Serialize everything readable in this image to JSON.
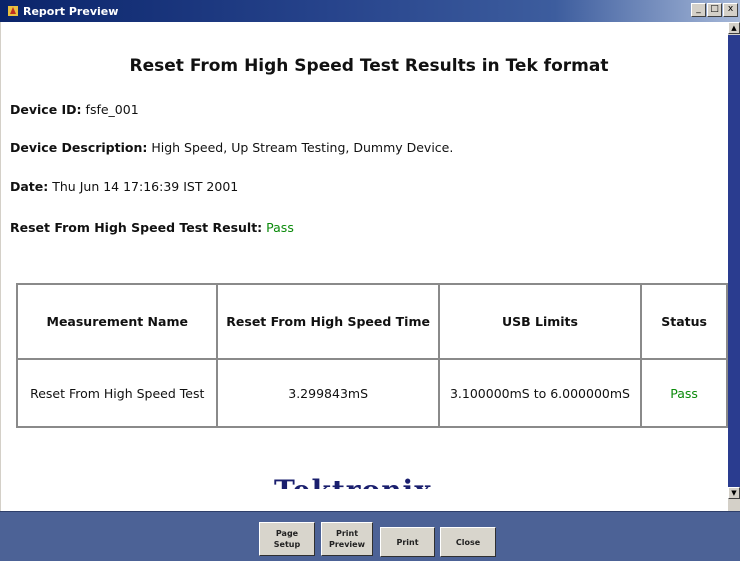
{
  "window": {
    "title": "Report Preview",
    "controls": {
      "minimize": "_",
      "maximize": "□",
      "close": "x"
    }
  },
  "report": {
    "title": "Reset From High Speed Test Results in Tek format",
    "device_id_label": "Device ID:",
    "device_id": "fsfe_001",
    "device_description_label": "Device Description:",
    "device_description": "High Speed, Up Stream Testing, Dummy Device.",
    "date_label": "Date:",
    "date": "Thu Jun 14 17:16:39 IST 2001",
    "result_label": "Reset From High Speed Test Result:",
    "result": "Pass",
    "table": {
      "headers": [
        "Measurement Name",
        "Reset From High Speed Time",
        "USB Limits",
        "Status"
      ],
      "rows": [
        [
          "Reset From High Speed Test",
          "3.299843mS",
          "3.100000mS to 6.000000mS",
          "Pass"
        ]
      ]
    },
    "logo_text": "Tektronix"
  },
  "toolbar": {
    "page_setup": "Page\nSetup",
    "print_preview": "Print\nPreview",
    "print": "Print",
    "close": "Close"
  },
  "colors": {
    "pass": "#0a8a0a",
    "titlebar": "#0a246a",
    "toolbar": "#4c6296"
  }
}
